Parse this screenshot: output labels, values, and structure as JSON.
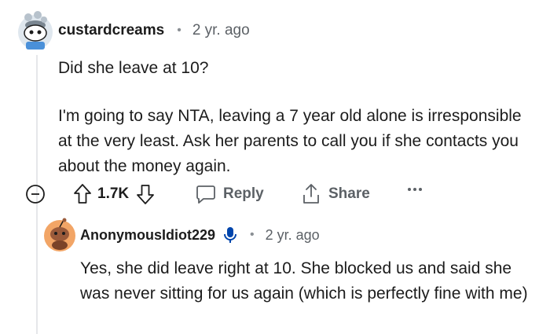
{
  "comment": {
    "username": "custardcreams",
    "time": "2 yr. ago",
    "separator": "•",
    "paragraph1": "Did she leave at 10?",
    "paragraph2": "I'm going to say NTA, leaving a 7 year old alone is irresponsible at the very least. Ask her parents to call you if she contacts you about the money again."
  },
  "actions": {
    "score": "1.7K",
    "reply_label": "Reply",
    "share_label": "Share"
  },
  "reply": {
    "username": "AnonymousIdiot229",
    "time": "2 yr. ago",
    "separator": "•",
    "text": "Yes, she did leave right at 10. She blocked us and said she was never sitting for us again (which is perfectly fine with me)"
  },
  "colors": {
    "text": "#1c1c1c",
    "meta": "#5c6166",
    "thread_line": "#e5e7ea",
    "mic_blue": "#0045ac",
    "avatar_orange": "#f2a566"
  }
}
